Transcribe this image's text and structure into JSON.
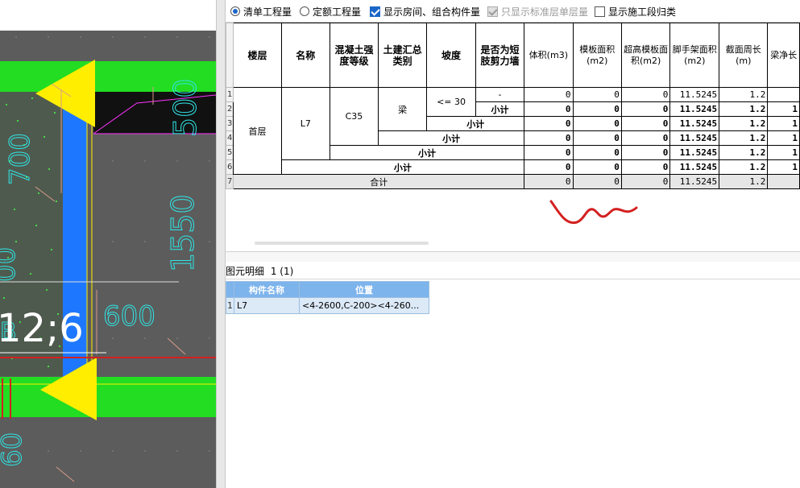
{
  "cad_view": {
    "dimension_labels": [
      "700",
      "500",
      "1550",
      "600",
      "00",
      "60"
    ],
    "axis_label": "12;6",
    "axis_bubble": "B"
  },
  "options": {
    "qingdan": {
      "label": "清单工程量",
      "checked": true
    },
    "dinge": {
      "label": "定额工程量",
      "checked": false
    },
    "show_room": {
      "label": "显示房间、组合构件量",
      "checked": true
    },
    "std_floor": {
      "label": "只显示标准层单层量",
      "checked": true,
      "disabled": true
    },
    "section": {
      "label": "显示施工段归类",
      "checked": false
    }
  },
  "quantity_table": {
    "headers": {
      "floor": "楼层",
      "name": "名称",
      "concrete": "混凝土强度等级",
      "category": "土建汇总类别",
      "slope": "坡度",
      "shortwall": "是否为短肢剪力墙",
      "volume": "体积(m3)",
      "formwork": "模板面积(m2)",
      "over_formwork": "超高模板面积(m2)",
      "scaffold": "脚手架面积(m2)",
      "perimeter": "截面周长(m)",
      "net_length": "梁净长"
    },
    "row_numbers": [
      "1",
      "2",
      "3",
      "4",
      "5",
      "6",
      "7"
    ],
    "floor": "首层",
    "name": "L7",
    "concrete": "C35",
    "category": "梁",
    "slope": "<= 30",
    "shortwall_value": "-",
    "subtotal": "小计",
    "total": "合计",
    "rows": [
      {
        "volume": "0",
        "formwork": "0",
        "over": "0",
        "scaffold": "11.5245",
        "perimeter": "1.2",
        "net": ""
      },
      {
        "volume": "0",
        "formwork": "0",
        "over": "0",
        "scaffold": "11.5245",
        "perimeter": "1.2",
        "net": "1"
      },
      {
        "volume": "0",
        "formwork": "0",
        "over": "0",
        "scaffold": "11.5245",
        "perimeter": "1.2",
        "net": "1"
      },
      {
        "volume": "0",
        "formwork": "0",
        "over": "0",
        "scaffold": "11.5245",
        "perimeter": "1.2",
        "net": "1"
      },
      {
        "volume": "0",
        "formwork": "0",
        "over": "0",
        "scaffold": "11.5245",
        "perimeter": "1.2",
        "net": "1"
      },
      {
        "volume": "0",
        "formwork": "0",
        "over": "0",
        "scaffold": "11.5245",
        "perimeter": "1.2",
        "net": "1"
      },
      {
        "volume": "0",
        "formwork": "0",
        "over": "0",
        "scaffold": "11.5245",
        "perimeter": "1.2",
        "net": ""
      }
    ]
  },
  "detail": {
    "title": "图元明细",
    "count": "1 (1)",
    "headers": {
      "name": "构件名称",
      "position": "位置"
    },
    "row": {
      "num": "1",
      "name": "L7",
      "position": "<4-2600,C-200><4-260..."
    }
  },
  "colors": {
    "cad_bg": "#5c5c5c",
    "beam_green": "#22dd22",
    "beam_blue": "#1e78ff",
    "arrow_yellow": "#ffee00",
    "dim_cyan": "#2ee6e6",
    "annotation_red": "#d42020"
  }
}
